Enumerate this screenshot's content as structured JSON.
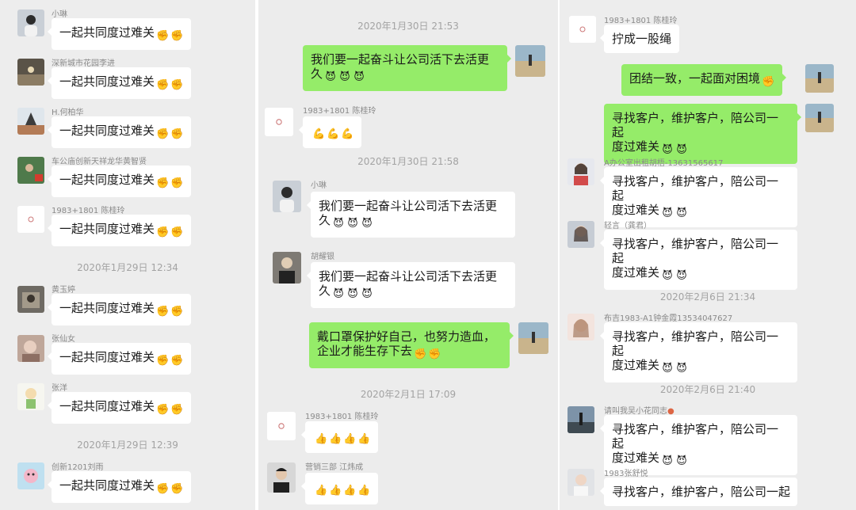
{
  "col1": {
    "messages": [
      {
        "sender": "小琳",
        "text": "一起共同度过难关"
      },
      {
        "sender": "深新城市花园李进",
        "text": "一起共同度过难关"
      },
      {
        "sender": "H.何柏华",
        "text": "一起共同度过难关"
      },
      {
        "sender": "车公庙创新天祥龙华黄智贤",
        "text": "一起共同度过难关"
      },
      {
        "sender": "1983+1801 陈桂玲",
        "text": "一起共同度过难关"
      },
      {
        "sender": "黄玉婷",
        "text": "一起共同度过难关"
      },
      {
        "sender": "张仙女",
        "text": "一起共同度过难关"
      },
      {
        "sender": "张洋",
        "text": "一起共同度过难关"
      },
      {
        "sender": "创新1201刘雨",
        "text": "一起共同度过难关"
      }
    ],
    "timestamps": [
      "2020年1月29日 12:34",
      "2020年1月29日 12:39"
    ]
  },
  "col2": {
    "timestamps": [
      "2020年1月30日 21:53",
      "2020年1月30日 21:58",
      "2020年2月1日 17:09"
    ],
    "messages": [
      {
        "sender": "",
        "line1": "我们要一起奋斗让公司活下去活更",
        "line2": "久"
      },
      {
        "sender": "1983+1801 陈桂玲",
        "line1": "",
        "line2": ""
      },
      {
        "sender": "小琳",
        "line1": "我们要一起奋斗让公司活下去活更",
        "line2": "久"
      },
      {
        "sender": "胡耀银",
        "line1": "我们要一起奋斗让公司活下去活更",
        "line2": "久"
      },
      {
        "sender": "",
        "line1": "戴口罩保护好自己，也努力造血，",
        "line2": "企业才能生存下去"
      },
      {
        "sender": "1983+1801 陈桂玲",
        "line1": "",
        "line2": ""
      },
      {
        "sender": "营销三部 江炜成",
        "line1": "",
        "line2": ""
      }
    ]
  },
  "col3": {
    "timestamps": [
      "2020年2月6日 21:34",
      "2020年2月6日 21:40"
    ],
    "messages": [
      {
        "sender": "1983+1801 陈桂玲",
        "line1": "拧成一股绳",
        "line2": ""
      },
      {
        "sender": "",
        "line1": "团结一致，一起面对困境",
        "line2": ""
      },
      {
        "sender": "",
        "line1": "寻找客户，维护客户，陪公司一起",
        "line2": "度过难关"
      },
      {
        "sender": "A办公室出租胡梧-13631565617",
        "line1": "寻找客户，维护客户，陪公司一起",
        "line2": "度过难关"
      },
      {
        "sender": "轻言（龚君）",
        "line1": "寻找客户，维护客户，陪公司一起",
        "line2": "度过难关"
      },
      {
        "sender": "布吉1983-A1钟金霞13534047627",
        "line1": "寻找客户，维护客户，陪公司一起",
        "line2": "度过难关"
      },
      {
        "sender": "请叫我吴小花同志",
        "line1": "寻找客户，维护客户，陪公司一起",
        "line2": "度过难关"
      },
      {
        "sender": "1983张舒悦",
        "line1": "寻找客户，维护客户，陪公司一起",
        "line2": ""
      }
    ]
  },
  "emoji": {
    "fist": "✊",
    "devil": "😈",
    "muscle": "💪",
    "thumb": "👍"
  },
  "colors": {
    "background": "#ededed",
    "incoming_bubble": "#ffffff",
    "outgoing_bubble": "#95ec69",
    "timestamp": "#a3a3a3",
    "name": "#8a8a8a"
  }
}
